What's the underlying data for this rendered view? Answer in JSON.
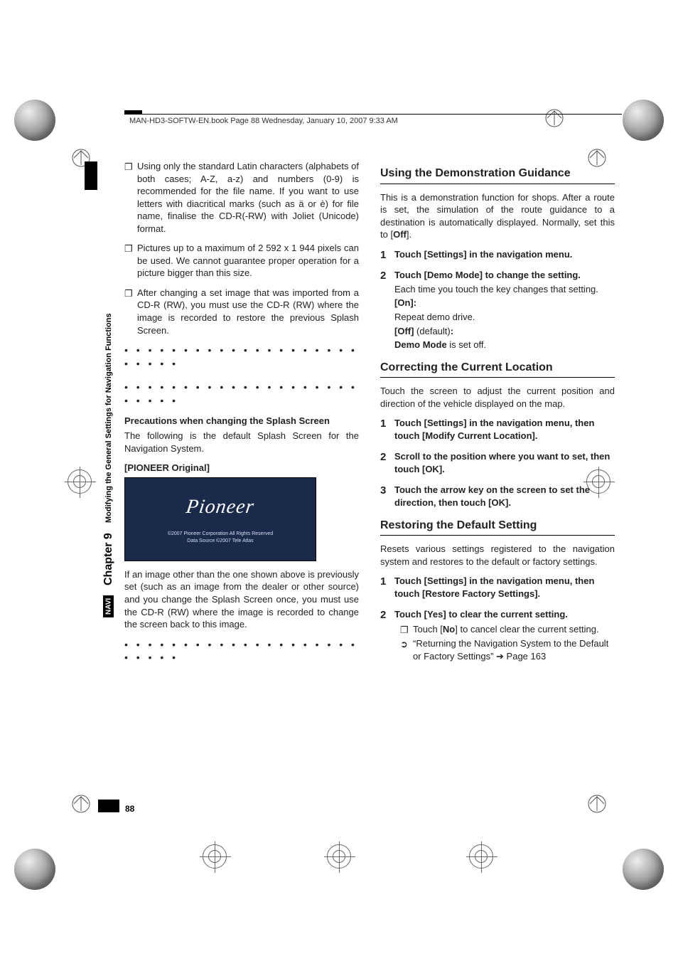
{
  "header_running": "MAN-HD3-SOFTW-EN.book  Page 88  Wednesday, January 10, 2007  9:33 AM",
  "side": {
    "navi": "NAVI",
    "chapter": "Chapter 9",
    "section": "Modifying the General Settings for Navigation Functions"
  },
  "left": {
    "bullets": [
      "Using only the standard Latin characters (alphabets of both cases; A-Z, a-z) and numbers (0-9) is recommended for the file name. If you want to use letters with diacritical marks (such as ä or è) for file name, finalise the CD-R(-RW) with Joliet (Unicode) format.",
      "Pictures up to a maximum of 2 592 x 1 944 pixels can be used. We cannot guarantee proper operation for a picture bigger than this size.",
      "After changing a set image that was imported from a CD-R (RW), you must use the CD-R (RW) where the image is recorded to restore the previous Splash Screen."
    ],
    "precaution_title": "Precautions when changing the Splash Screen",
    "precaution_body": "The following is the default Splash Screen for the Navigation System.",
    "pioneer_label": "[PIONEER Original]",
    "splash_logo": "Pioneer",
    "splash_fine1": "©2007 Pioneer Corporation All Rights Reserved",
    "splash_fine2": "Data Source ©2007 Tele Atlas",
    "after_image": "If an image other than the one shown above is previously set (such as an image from the dealer or other source) and you change the Splash Screen once, you must use the CD-R (RW) where the image is recorded to change the screen back to this image."
  },
  "right": {
    "s1_title": "Using the Demonstration Guidance",
    "s1_body": "This is a demonstration function for shops. After a route is set, the simulation of the route guidance to a destination is automatically displayed. Normally, set this to [",
    "s1_body_off": "Off",
    "s1_body_end": "].",
    "s1_step1": "Touch [Settings] in the navigation menu.",
    "s1_step2_lead": "Touch [Demo Mode] to change the setting.",
    "s1_step2_body": "Each time you touch the key changes that setting.",
    "s1_on": "[On]:",
    "s1_on_desc": "Repeat demo drive.",
    "s1_off": "[Off]",
    "s1_off_paren": " (default)",
    "s1_off_colon": ":",
    "s1_off_desc_pre": "Demo Mode",
    "s1_off_desc_post": " is set off.",
    "s2_title": "Correcting the Current Location",
    "s2_body": "Touch the screen to adjust the current position and direction of the vehicle displayed on the map.",
    "s2_step1": "Touch [Settings] in the navigation menu, then touch [Modify Current Location].",
    "s2_step2": "Scroll to the position where you want to set, then touch [OK].",
    "s2_step3": "Touch the arrow key on the screen to set the direction, then touch [OK].",
    "s3_title": "Restoring the Default Setting",
    "s3_body": "Resets various settings registered to the navigation system and restores to the default or factory settings.",
    "s3_step1": "Touch [Settings] in the navigation menu, then touch [Restore Factory Settings].",
    "s3_step2_lead": "Touch [Yes] to clear the current setting.",
    "s3_sub_bullet_pre": "Touch [",
    "s3_sub_bullet_no": "No",
    "s3_sub_bullet_post": "] to cancel clear the current setting.",
    "s3_xref": "“Returning the Navigation System to the Default or Factory Settings” ➔ Page 163"
  },
  "page_number": "88"
}
